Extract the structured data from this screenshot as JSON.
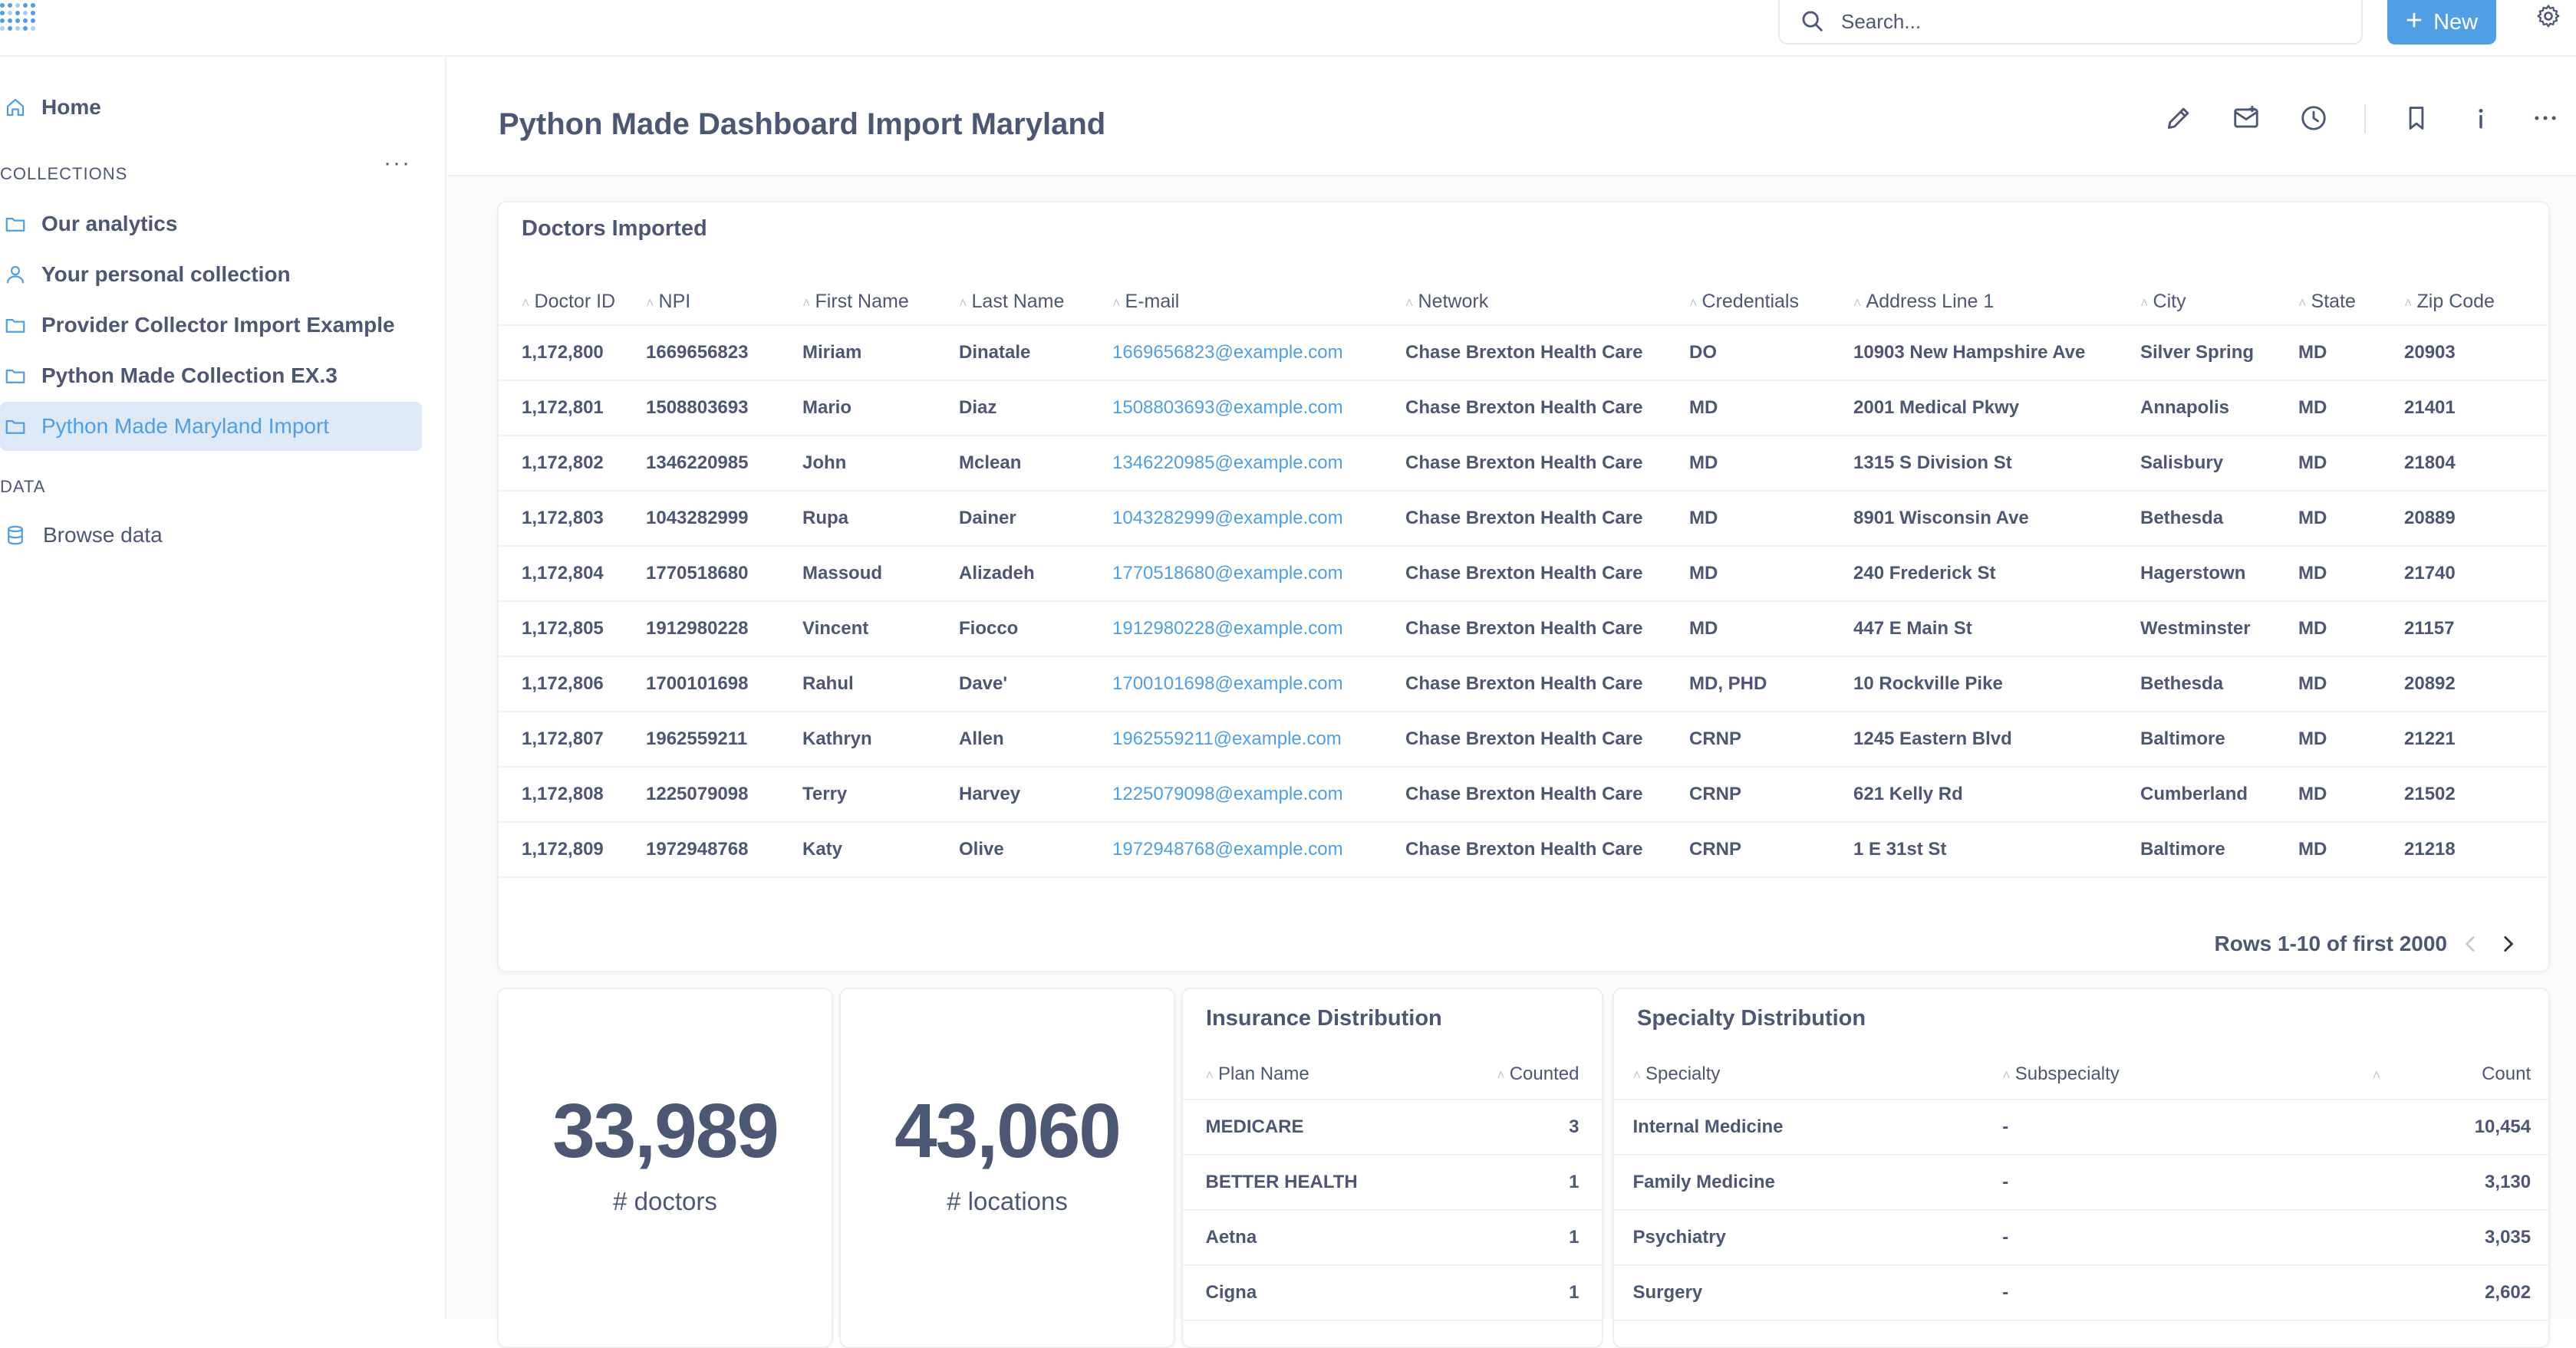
{
  "topbar": {
    "search_placeholder": "Search...",
    "new_label": "New"
  },
  "sidebar": {
    "home_label": "Home",
    "collections_header": "COLLECTIONS",
    "collections": [
      {
        "label": "Our analytics",
        "icon": "folder-icon"
      },
      {
        "label": "Your personal collection",
        "icon": "person-icon"
      },
      {
        "label": "Provider Collector Import Example",
        "icon": "folder-icon"
      },
      {
        "label": "Python Made Collection EX.3",
        "icon": "folder-icon"
      },
      {
        "label": "Python Made Maryland Import",
        "icon": "folder-icon",
        "active": true
      }
    ],
    "data_header": "DATA",
    "browse_label": "Browse data"
  },
  "dashboard": {
    "title": "Python Made Dashboard Import Maryland"
  },
  "doctors_card": {
    "title": "Doctors Imported",
    "columns": [
      "Doctor ID",
      "NPI",
      "First Name",
      "Last Name",
      "E-mail",
      "Network",
      "Credentials",
      "Address Line 1",
      "City",
      "State",
      "Zip Code"
    ],
    "rows": [
      [
        "1,172,800",
        "1669656823",
        "Miriam",
        "Dinatale",
        "1669656823@example.com",
        "Chase Brexton Health Care",
        "DO",
        "10903 New Hampshire Ave",
        "Silver Spring",
        "MD",
        "20903"
      ],
      [
        "1,172,801",
        "1508803693",
        "Mario",
        "Diaz",
        "1508803693@example.com",
        "Chase Brexton Health Care",
        "MD",
        "2001 Medical Pkwy",
        "Annapolis",
        "MD",
        "21401"
      ],
      [
        "1,172,802",
        "1346220985",
        "John",
        "Mclean",
        "1346220985@example.com",
        "Chase Brexton Health Care",
        "MD",
        "1315 S Division St",
        "Salisbury",
        "MD",
        "21804"
      ],
      [
        "1,172,803",
        "1043282999",
        "Rupa",
        "Dainer",
        "1043282999@example.com",
        "Chase Brexton Health Care",
        "MD",
        "8901 Wisconsin Ave",
        "Bethesda",
        "MD",
        "20889"
      ],
      [
        "1,172,804",
        "1770518680",
        "Massoud",
        "Alizadeh",
        "1770518680@example.com",
        "Chase Brexton Health Care",
        "MD",
        "240 Frederick St",
        "Hagerstown",
        "MD",
        "21740"
      ],
      [
        "1,172,805",
        "1912980228",
        "Vincent",
        "Fiocco",
        "1912980228@example.com",
        "Chase Brexton Health Care",
        "MD",
        "447 E Main St",
        "Westminster",
        "MD",
        "21157"
      ],
      [
        "1,172,806",
        "1700101698",
        "Rahul",
        "Dave'",
        "1700101698@example.com",
        "Chase Brexton Health Care",
        "MD, PHD",
        "10 Rockville Pike",
        "Bethesda",
        "MD",
        "20892"
      ],
      [
        "1,172,807",
        "1962559211",
        "Kathryn",
        "Allen",
        "1962559211@example.com",
        "Chase Brexton Health Care",
        "CRNP",
        "1245 Eastern Blvd",
        "Baltimore",
        "MD",
        "21221"
      ],
      [
        "1,172,808",
        "1225079098",
        "Terry",
        "Harvey",
        "1225079098@example.com",
        "Chase Brexton Health Care",
        "CRNP",
        "621 Kelly Rd",
        "Cumberland",
        "MD",
        "21502"
      ],
      [
        "1,172,809",
        "1972948768",
        "Katy",
        "Olive",
        "1972948768@example.com",
        "Chase Brexton Health Care",
        "CRNP",
        "1 E 31st St",
        "Baltimore",
        "MD",
        "21218"
      ]
    ],
    "pagination": "Rows 1-10 of first 2000"
  },
  "kpis": [
    {
      "value": "33,989",
      "label": "# doctors"
    },
    {
      "value": "43,060",
      "label": "# locations"
    }
  ],
  "insurance_card": {
    "title": "Insurance Distribution",
    "columns": [
      "Plan Name",
      "Counted"
    ],
    "rows": [
      [
        "MEDICARE",
        "3"
      ],
      [
        "BETTER HEALTH",
        "1"
      ],
      [
        "Aetna",
        "1"
      ],
      [
        "Cigna",
        "1"
      ]
    ]
  },
  "specialty_card": {
    "title": "Specialty Distribution",
    "columns": [
      "Specialty",
      "Subspecialty",
      "Count"
    ],
    "rows": [
      [
        "Internal Medicine",
        "-",
        "10,454"
      ],
      [
        "Family Medicine",
        "-",
        "3,130"
      ],
      [
        "Psychiatry",
        "-",
        "3,035"
      ],
      [
        "Surgery",
        "-",
        "2,602"
      ]
    ]
  },
  "colors": {
    "brand": "#509ee3",
    "text": "#4c5773",
    "active_bg": "#dde9f6"
  }
}
